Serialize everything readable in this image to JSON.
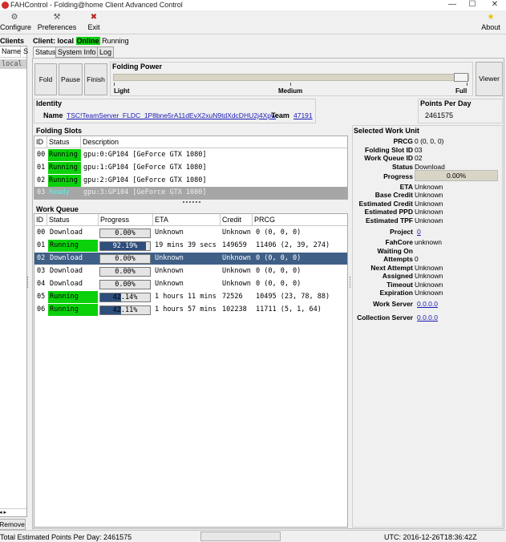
{
  "window": {
    "title": "FAHControl - Folding@home Client Advanced Control",
    "min": "—",
    "max": "☐",
    "close": "✕"
  },
  "toolbar": {
    "configure": "Configure",
    "preferences": "Preferences",
    "exit": "Exit",
    "about": "About"
  },
  "clients_panel": {
    "header": "Clients",
    "col_name": "Name",
    "col_s": "S",
    "item": "local",
    "remove": "Remove"
  },
  "client": {
    "label": "Client: local",
    "online": "Online",
    "running": "Running"
  },
  "tabs": [
    "Status",
    "System Info",
    "Log"
  ],
  "controls": {
    "fold": "Fold",
    "pause": "Pause",
    "finish": "Finish",
    "viewer": "Viewer"
  },
  "power": {
    "title": "Folding Power",
    "light": "Light",
    "medium": "Medium",
    "full": "Full",
    "level": 1.0
  },
  "identity": {
    "title": "Identity",
    "name_label": "Name",
    "name": "TSC!TeamServer_FLDC_1P8bne5rA11dEvX2xuN9tdXdcDHU2j4Xpw",
    "team_label": "Team",
    "team": "47191"
  },
  "ppd": {
    "title": "Points Per Day",
    "value": "2461575"
  },
  "slots": {
    "title": "Folding Slots",
    "headers": [
      "ID",
      "Status",
      "Description"
    ],
    "rows": [
      {
        "id": "00",
        "status": "Running",
        "desc": "gpu:0:GP104 [GeForce GTX 1080]"
      },
      {
        "id": "01",
        "status": "Running",
        "desc": "gpu:1:GP104 [GeForce GTX 1080]"
      },
      {
        "id": "02",
        "status": "Running",
        "desc": "gpu:2:GP104 [GeForce GTX 1080]"
      },
      {
        "id": "03",
        "status": "Ready",
        "desc": "gpu:3:GP104 [GeForce GTX 1080]"
      }
    ]
  },
  "queue": {
    "title": "Work Queue",
    "headers": [
      "ID",
      "Status",
      "Progress",
      "ETA",
      "Credit",
      "PRCG"
    ],
    "rows": [
      {
        "id": "00",
        "status": "Download",
        "progress": "0.00%",
        "pct": 0,
        "eta": "Unknown",
        "credit": "Unknown",
        "prcg": "0 (0, 0, 0)"
      },
      {
        "id": "01",
        "status": "Running",
        "progress": "92.19%",
        "pct": 92.19,
        "eta": "19 mins 39 secs",
        "credit": "149659",
        "prcg": "11406 (2, 39, 274)"
      },
      {
        "id": "02",
        "status": "Download",
        "progress": "0.00%",
        "pct": 0,
        "eta": "Unknown",
        "credit": "Unknown",
        "prcg": "0 (0, 0, 0)"
      },
      {
        "id": "03",
        "status": "Download",
        "progress": "0.00%",
        "pct": 0,
        "eta": "Unknown",
        "credit": "Unknown",
        "prcg": "0 (0, 0, 0)"
      },
      {
        "id": "04",
        "status": "Download",
        "progress": "0.00%",
        "pct": 0,
        "eta": "Unknown",
        "credit": "Unknown",
        "prcg": "0 (0, 0, 0)"
      },
      {
        "id": "05",
        "status": "Running",
        "progress": "42.14%",
        "pct": 42.14,
        "eta": "1 hours 11 mins",
        "credit": "72526",
        "prcg": "10495 (23, 78, 88)"
      },
      {
        "id": "06",
        "status": "Running",
        "progress": "42.11%",
        "pct": 42.11,
        "eta": "1 hours 57 mins",
        "credit": "102238",
        "prcg": "11711 (5, 1, 64)"
      }
    ]
  },
  "wu": {
    "title": "Selected Work Unit",
    "prcg": {
      "label": "PRCG",
      "value": "0 (0, 0, 0)"
    },
    "slot": {
      "label": "Folding Slot ID",
      "value": "03"
    },
    "queue": {
      "label": "Work Queue ID",
      "value": "02"
    },
    "status": {
      "label": "Status",
      "value": "Download"
    },
    "progress": {
      "label": "Progress",
      "value": "0.00%"
    },
    "eta": {
      "label": "ETA",
      "value": "Unknown"
    },
    "base": {
      "label": "Base Credit",
      "value": "Unknown"
    },
    "est_credit": {
      "label": "Estimated Credit",
      "value": "Unknown"
    },
    "est_ppd": {
      "label": "Estimated PPD",
      "value": "Unknown"
    },
    "est_tpf": {
      "label": "Estimated TPF",
      "value": "Unknown"
    },
    "project": {
      "label": "Project",
      "value": "0"
    },
    "fahcore": {
      "label": "FahCore",
      "value": "unknown"
    },
    "waiting": {
      "label": "Waiting On",
      "value": ""
    },
    "attempts": {
      "label": "Attempts",
      "value": "0"
    },
    "next": {
      "label": "Next Attempt",
      "value": "Unknown"
    },
    "assigned": {
      "label": "Assigned",
      "value": "Unknown"
    },
    "timeout": {
      "label": "Timeout",
      "value": "Unknown"
    },
    "expiration": {
      "label": "Expiration",
      "value": "Unknown"
    },
    "work_server": {
      "label": "Work Server",
      "value": "0.0.0.0"
    },
    "collection_server": {
      "label": "Collection Server",
      "value": "0.0.0.0"
    }
  },
  "statusbar": {
    "total": "Total Estimated Points Per Day: 2461575",
    "utc": "UTC: 2016-12-26T18:36:42Z"
  },
  "colors": {
    "running": "#0bd10b",
    "ready": "#5ef0e0",
    "selected_row": "#3f5f86",
    "progress_fill": "#2e4e7b"
  }
}
